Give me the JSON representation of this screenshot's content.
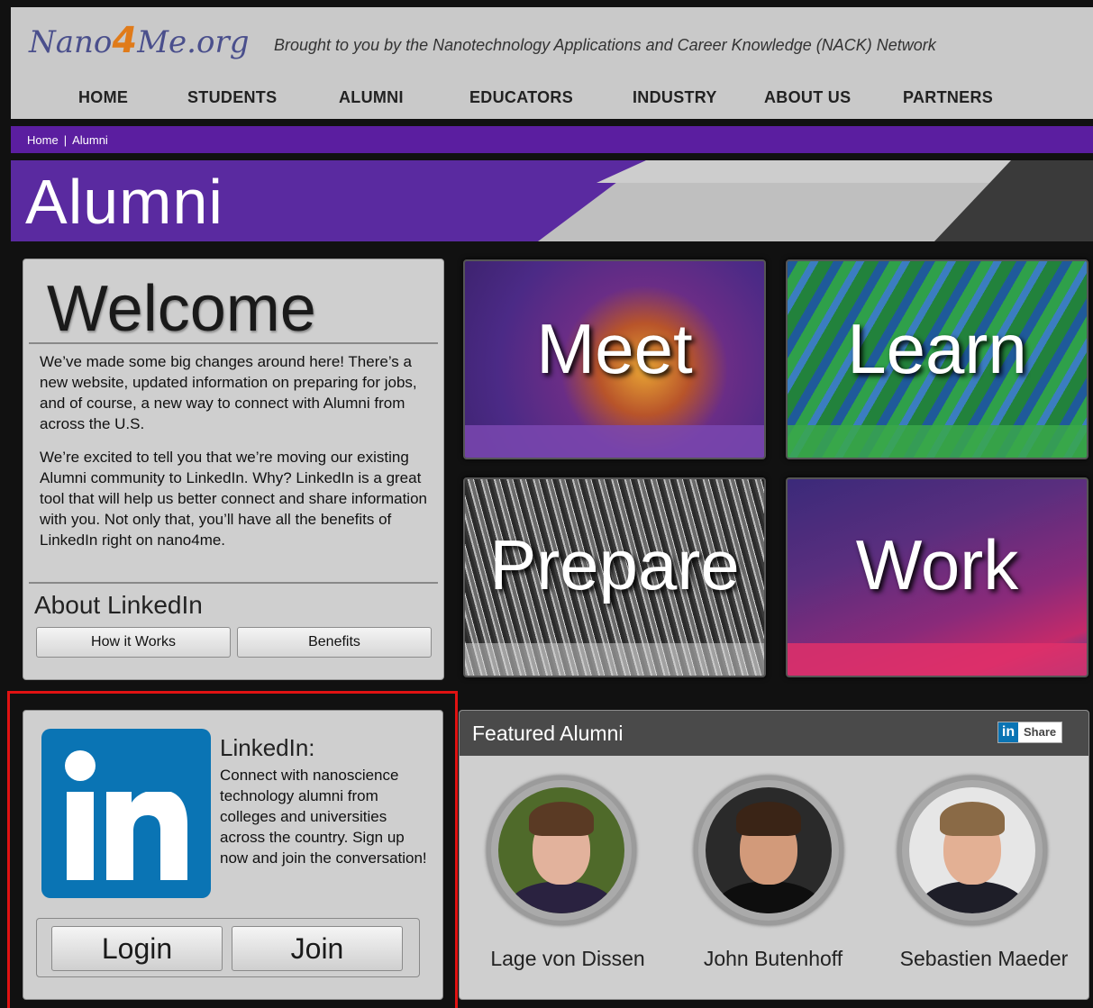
{
  "site": {
    "logo_prefix": "Nano",
    "logo_four": "4",
    "logo_suffix": "Me.org",
    "tagline": "Brought to you by the Nanotechnology Applications and Career Knowledge (NACK) Network"
  },
  "nav": [
    "HOME",
    "STUDENTS",
    "ALUMNI",
    "EDUCATORS",
    "INDUSTRY",
    "ABOUT US",
    "PARTNERS"
  ],
  "breadcrumb": {
    "home": "Home",
    "separator": "|",
    "current": "Alumni"
  },
  "banner": {
    "title": "Alumni"
  },
  "welcome": {
    "heading": "Welcome",
    "para1": "We’ve made some big changes around here! There’s a new website, updated information on preparing for jobs, and of course, a new way to connect with Alumni from across the U.S.",
    "para2": "We’re excited to tell you that we’re moving our existing Alumni community to LinkedIn. Why? LinkedIn is a great tool that will help us better connect and share information with you. Not only that, you’ll have all the benefits of LinkedIn right on nano4me.",
    "about_heading": "About LinkedIn",
    "btn_how": "How it Works",
    "btn_benefits": "Benefits"
  },
  "tiles": {
    "meet": "Meet",
    "learn": "Learn",
    "prepare": "Prepare",
    "work": "Work"
  },
  "linkedin": {
    "heading": "LinkedIn:",
    "text": "Connect with nanoscience technology alumni from colleges and universities across the country. Sign up now and join the conversation!",
    "login": "Login",
    "join": "Join"
  },
  "featured": {
    "title": "Featured Alumni",
    "share_in": "in",
    "share_label": "Share",
    "alumni": [
      "Lage von Dissen",
      "John Butenhoff",
      "Sebastien Maeder"
    ]
  },
  "colors": {
    "purple": "#5b1ea0",
    "linkedin_blue": "#0a74b4",
    "highlight_red": "#e01212"
  }
}
